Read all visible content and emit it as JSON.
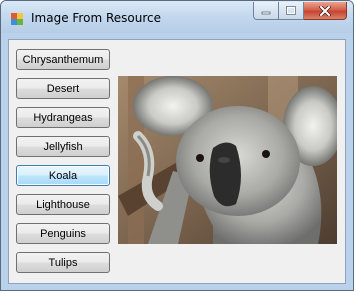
{
  "window": {
    "title": "Image From Resource",
    "icon": "windows-forms-app-icon",
    "controls": [
      "minimize-icon",
      "maximize-icon",
      "close-icon"
    ]
  },
  "buttons": [
    {
      "label": "Chrysanthemum",
      "selected": false
    },
    {
      "label": "Desert",
      "selected": false
    },
    {
      "label": "Hydrangeas",
      "selected": false
    },
    {
      "label": "Jellyfish",
      "selected": false
    },
    {
      "label": "Koala",
      "selected": true
    },
    {
      "label": "Lighthouse",
      "selected": false
    },
    {
      "label": "Penguins",
      "selected": false
    },
    {
      "label": "Tulips",
      "selected": false
    }
  ],
  "picture_box": {
    "content": "koala photo"
  },
  "colors": {
    "selected_button_border": "#3c7fb1",
    "close_button": "#c74430"
  }
}
